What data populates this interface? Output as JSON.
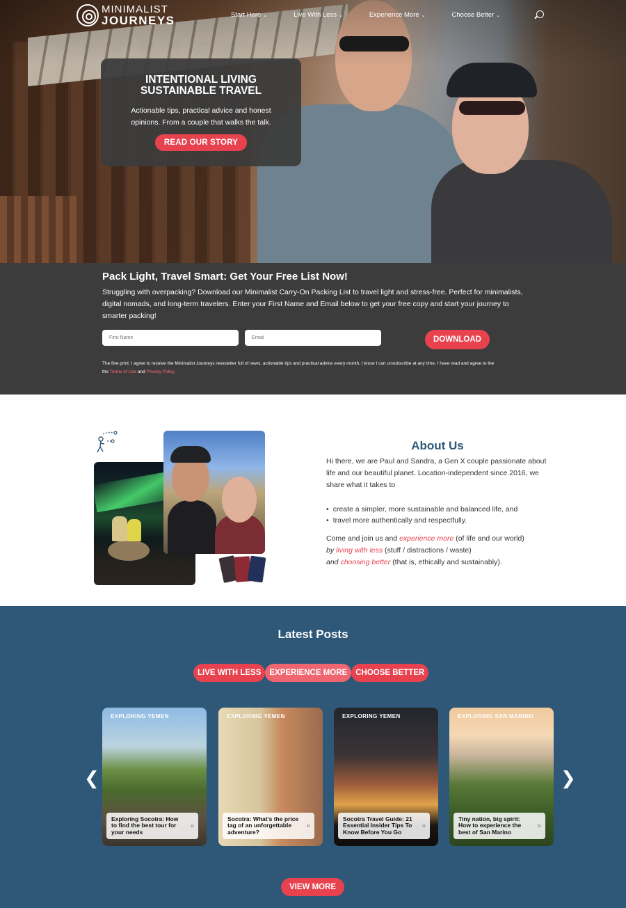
{
  "brand": {
    "line1": "MINIMALIST",
    "line2": "JOURNEYS"
  },
  "nav": {
    "items": [
      {
        "label": "Start Here"
      },
      {
        "label": "Live With Less"
      },
      {
        "label": "Experience More"
      },
      {
        "label": "Choose Better"
      }
    ]
  },
  "hero": {
    "title_line1": "INTENTIONAL LIVING",
    "title_line2": "SUSTAINABLE TRAVEL",
    "text": "Actionable tips, practical advice and honest opinions. From a couple that walks the talk.",
    "button": "READ OUR STORY"
  },
  "signup": {
    "title": "Pack Light, Travel Smart: Get Your Free List Now!",
    "description": "Struggling with overpacking? Download our Minimalist Carry-On Packing List to travel light and stress-free. Perfect for minimalists, digital nomads, and long-term travelers. Enter your First Name and Email below to get your free copy and start your journey to smarter packing!",
    "first_name_placeholder": "First Name",
    "email_placeholder": "Email",
    "button": "DOWNLOAD",
    "fine_print": "The fine print: I agree to receive the Minimalist Journeys newsletter full of news, actionable tips and practical advice every month. I know I can unsubscribe at any time. I have read and agree to the",
    "terms_link": "Terms of Use",
    "and": "and",
    "privacy_link": "Privacy Policy"
  },
  "about": {
    "title": "About Us",
    "intro": "Hi there, we are Paul and Sandra, a Gen X couple passionate about life and our beautiful planet. Location-independent since 2016, we share what it takes to",
    "list": [
      "create a simpler, more sustainable and balanced life, and",
      "travel more authentically and respectfully."
    ],
    "join_pre": "Come and join us and",
    "join_link1": "experience more",
    "join_mid1": "(of life and our world)",
    "join_by": "by",
    "join_link2": "living with less",
    "join_mid2": "(stuff / distractions / waste)",
    "join_and": "and",
    "join_link3": "choosing better",
    "join_end": "(that is, ethically and sustainably)."
  },
  "latest": {
    "title": "Latest Posts",
    "tabs": [
      "LIVE WITH LESS",
      "EXPERIENCE MORE",
      "CHOOSE BETTER"
    ],
    "prev": "❮",
    "next": "❯",
    "posts": [
      {
        "category": "EXPLORING YEMEN",
        "title": "Exploring Socotra: How to find the best tour for your needs"
      },
      {
        "category": "EXPLORING YEMEN",
        "title": "Socotra: What's the price tag of an unforgettable adventure?"
      },
      {
        "category": "EXPLORING YEMEN",
        "title": "Socotra Travel Guide: 21 Essential Insider Tips To Know Before You Go"
      },
      {
        "category": "EXPLORING SAN MARINO",
        "title": "Tiny nation, big spirit: How to experience the best of San Marino"
      }
    ],
    "more_glyph": "»",
    "button": "VIEW MORE"
  },
  "colors": {
    "accent": "#e8424f",
    "dark_band": "#3c3c3c",
    "blue": "#2f5878"
  }
}
